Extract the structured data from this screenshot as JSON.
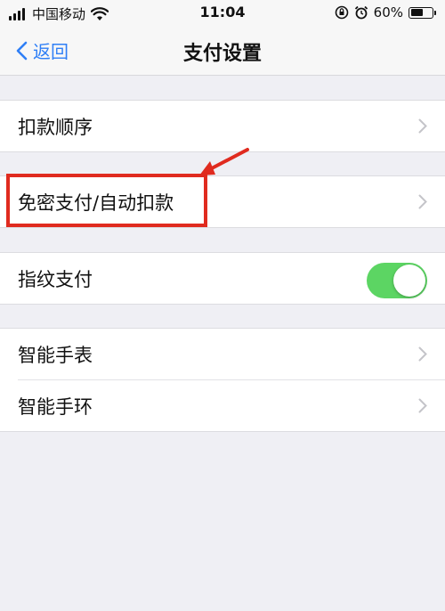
{
  "status_bar": {
    "carrier": "中国移动",
    "time": "11:04",
    "battery": "60%",
    "battery_level": 0.6,
    "icons": [
      "signal-icon",
      "wifi-icon",
      "rotation-lock-icon",
      "alarm-icon",
      "battery-icon"
    ]
  },
  "nav": {
    "back_label": "返回",
    "title": "支付设置"
  },
  "sections": [
    {
      "items": [
        {
          "label": "扣款顺序",
          "accessory": "chevron"
        }
      ]
    },
    {
      "items": [
        {
          "label": "免密支付/自动扣款",
          "accessory": "chevron",
          "highlighted": true
        }
      ]
    },
    {
      "items": [
        {
          "label": "指纹支付",
          "accessory": "toggle",
          "toggle_on": true
        }
      ]
    },
    {
      "items": [
        {
          "label": "智能手表",
          "accessory": "chevron"
        },
        {
          "label": "智能手环",
          "accessory": "chevron"
        }
      ]
    }
  ],
  "colors": {
    "accent": "#2f7ff6",
    "toggle_on": "#5cd563",
    "annotation": "#e02b1f",
    "background": "#efeff4"
  }
}
